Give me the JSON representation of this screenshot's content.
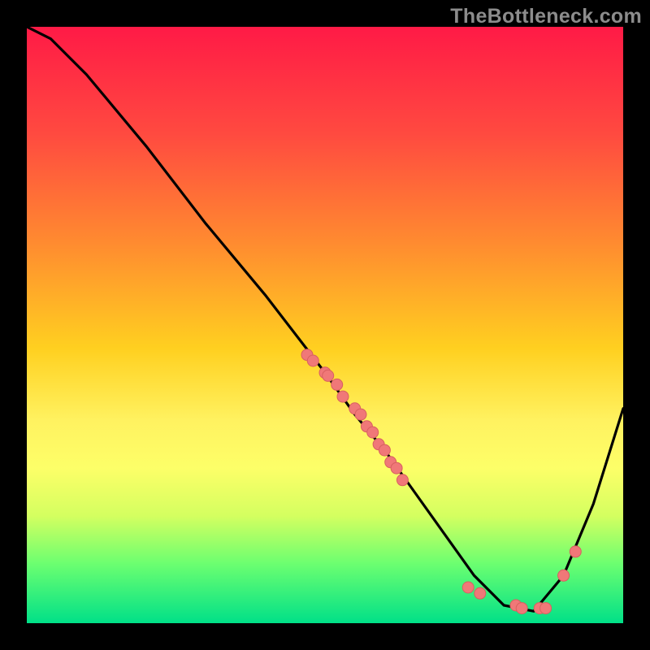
{
  "watermark": "TheBottleneck.com",
  "chart_data": {
    "type": "line",
    "title": "",
    "xlabel": "",
    "ylabel": "",
    "xlim": [
      0,
      100
    ],
    "ylim": [
      0,
      100
    ],
    "series": [
      {
        "name": "curve",
        "x": [
          0,
          4,
          10,
          20,
          30,
          40,
          50,
          55,
          60,
          65,
          70,
          75,
          80,
          85,
          90,
          95,
          100
        ],
        "y": [
          100,
          98,
          92,
          80,
          67,
          55,
          42,
          35,
          29,
          22,
          15,
          8,
          3,
          2,
          8,
          20,
          36
        ]
      }
    ],
    "dots": {
      "name": "points",
      "x": [
        47,
        48,
        50,
        50.5,
        52,
        53,
        55,
        56,
        57,
        58,
        59,
        60,
        61,
        62,
        63,
        74,
        76,
        82,
        83,
        86,
        87,
        90,
        92
      ],
      "y": [
        45,
        44,
        42,
        41.5,
        40,
        38,
        36,
        35,
        33,
        32,
        30,
        29,
        27,
        26,
        24,
        6,
        5,
        3,
        2.5,
        2.5,
        2.5,
        8,
        12
      ]
    },
    "background_gradient": {
      "top": "#ff1a46",
      "mid": "#fff260",
      "bottom": "#00e088"
    }
  }
}
